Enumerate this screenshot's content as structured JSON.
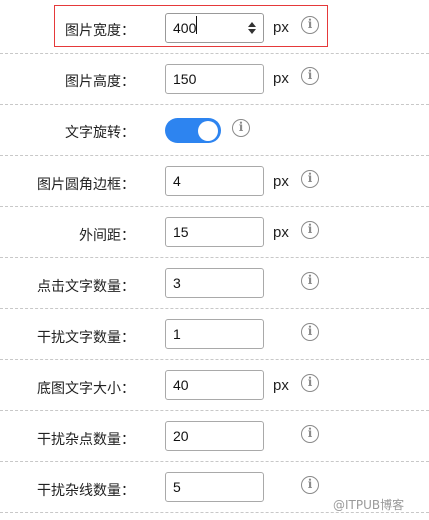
{
  "rows": [
    {
      "label": "图片宽度：",
      "value": "400",
      "unit": "px",
      "focused": true
    },
    {
      "label": "图片高度：",
      "value": "150",
      "unit": "px"
    },
    {
      "label": "文字旋转：",
      "toggle": true
    },
    {
      "label": "图片圆角边框：",
      "value": "4",
      "unit": "px"
    },
    {
      "label": "外间距：",
      "value": "15",
      "unit": "px"
    },
    {
      "label": "点击文字数量：",
      "value": "3",
      "unit": ""
    },
    {
      "label": "干扰文字数量：",
      "value": "1",
      "unit": ""
    },
    {
      "label": "底图文字大小：",
      "value": "40",
      "unit": "px"
    },
    {
      "label": "干扰杂点数量：",
      "value": "20",
      "unit": ""
    },
    {
      "label": "干扰杂线数量：",
      "value": "5",
      "unit": ""
    }
  ],
  "info_icon": {
    "glyph": "i",
    "name": "info-icon"
  },
  "colors": {
    "accent": "#2d84f0",
    "highlight_border": "#e5393a",
    "icon": "#8a8a8a"
  },
  "watermark": "@ITPUB博客"
}
